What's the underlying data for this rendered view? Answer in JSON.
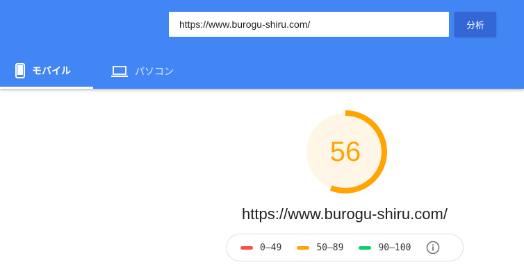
{
  "header": {
    "url_value": "https://www.burogu-shiru.com/",
    "analyze_label": "分析",
    "colors": {
      "header_bg": "#4285f4",
      "button_bg": "#3367d6"
    }
  },
  "tabs": [
    {
      "label": "モバイル",
      "icon": "smartphone-icon",
      "active": true
    },
    {
      "label": "パソコン",
      "icon": "laptop-icon",
      "active": false
    }
  ],
  "report": {
    "score": "56",
    "score_fraction": 0.56,
    "score_color": "#ffa400",
    "url": "https://www.burogu-shiru.com/"
  },
  "legend": [
    {
      "range": "0–49",
      "color": "#ff4e42"
    },
    {
      "range": "50–89",
      "color": "#ffa400"
    },
    {
      "range": "90–100",
      "color": "#0cce6b"
    }
  ],
  "info_icon": "info-icon"
}
